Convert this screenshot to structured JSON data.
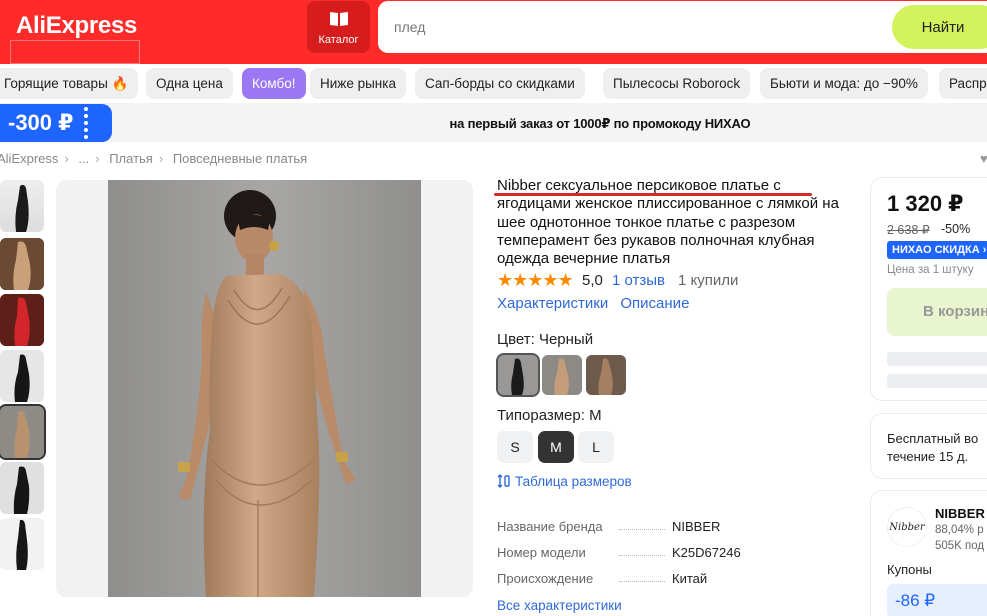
{
  "header": {
    "logo": "AliExpress",
    "catalog_label": "Каталог",
    "search_placeholder": "плед",
    "search_button": "Найти"
  },
  "chips": [
    {
      "label": "Горящие товары 🔥",
      "active": false
    },
    {
      "label": "Одна цена",
      "active": false
    },
    {
      "label": "Комбо!",
      "active": true
    },
    {
      "label": "Ниже рынка",
      "active": false
    },
    {
      "label": "Сап-борды со скидками",
      "active": false
    },
    {
      "label": "Пылесосы Roborock",
      "active": false
    },
    {
      "label": "Бьюти и мода: до −90%",
      "active": false
    },
    {
      "label": "Распр",
      "active": false
    }
  ],
  "promo": {
    "badge": "-300 ₽",
    "text": "на первый заказ от 1000₽ по промокоду НИХАО"
  },
  "breadcrumbs": [
    "AliExpress",
    "...",
    "Платья",
    "Повседневные платья"
  ],
  "product": {
    "title": "Nibber сексуальное персиковое платье с ягодицами женское плиссированное с лямкой на шее однотонное тонкое платье с разрезом темперамент без рукавов полночная клубная одежда вечерние платья",
    "stars": "★★★★★",
    "rating": "5,0",
    "reviews": "1 отзыв",
    "bought": "1 купили",
    "tab_specs": "Характеристики",
    "tab_description": "Описание",
    "color_label": "Цвет: Черный",
    "size_label": "Типоразмер: M",
    "sizes": [
      "S",
      "M",
      "L"
    ],
    "selected_size": "M",
    "size_table": "Таблица размеров",
    "specs": [
      {
        "key": "Название бренда",
        "value": "NIBBER"
      },
      {
        "key": "Номер модели",
        "value": "K25D67246"
      },
      {
        "key": "Происхождение",
        "value": "Китай"
      }
    ],
    "all_specs": "Все характеристики"
  },
  "buy_box": {
    "price": "1 320 ₽",
    "old_price": "2 638 ₽",
    "discount": "-50%",
    "badge": "НИХАО СКИДКА",
    "per_unit": "Цена за 1 штуку",
    "cart_button": "В корзин"
  },
  "delivery": {
    "text": "Бесплатный во течение 15 д."
  },
  "seller": {
    "logo_text": "Nibber",
    "name": "NIBBER",
    "rating": "88,04% р",
    "subscribers": "505K под",
    "coupons_label": "Купоны",
    "coupon": "-86 ₽"
  },
  "colors": {
    "header_red": "#ff2a2a",
    "search_button": "#d4f25b",
    "active_chip": "#9a77f3",
    "promo_blue": "#1e64ff",
    "link_blue": "#2f6ad9",
    "star_orange": "#ff8a00"
  }
}
